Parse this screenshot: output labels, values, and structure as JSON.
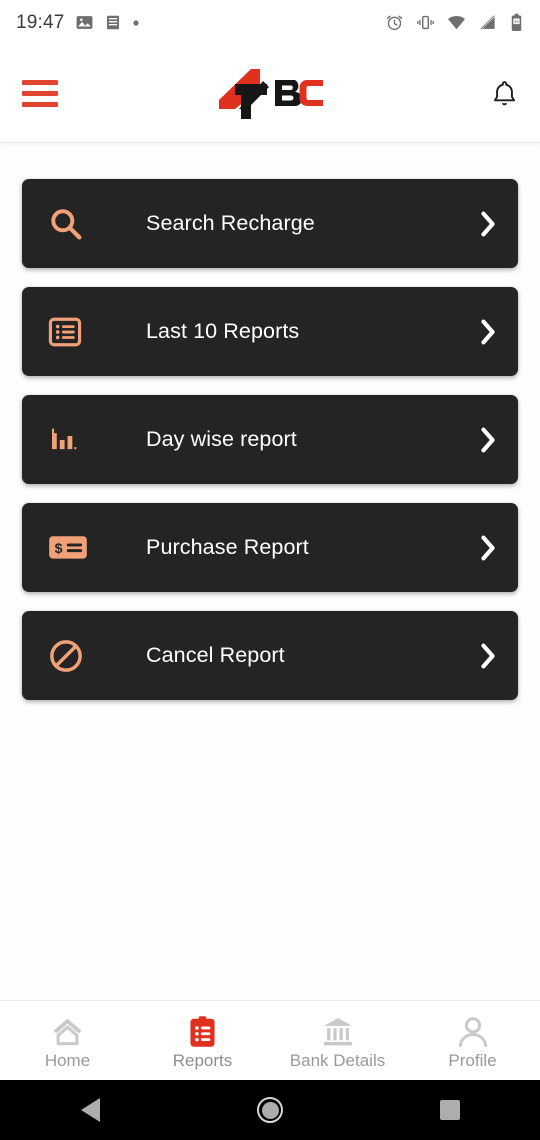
{
  "status_bar": {
    "time": "19:47",
    "left_icons": [
      "image-icon",
      "document-icon",
      "dot-icon"
    ],
    "right_icons": [
      "alarm-icon",
      "vibrate-icon",
      "wifi-icon",
      "signal-icon",
      "battery-icon"
    ]
  },
  "header": {
    "menu_icon": "hamburger-menu-icon",
    "logo_text": "47BC",
    "logo_parts": {
      "mark": "47",
      "b": "B",
      "c": "C"
    },
    "notification_icon": "bell-icon",
    "colors": {
      "menu": "#e0462f",
      "logo_red": "#e0301e",
      "logo_dark": "#1a1a1a"
    }
  },
  "menu_cards": [
    {
      "id": "search-recharge",
      "label": "Search Recharge",
      "icon": "search-icon",
      "chevron": "chevron-right-icon"
    },
    {
      "id": "last-10-reports",
      "label": "Last 10 Reports",
      "icon": "list-report-icon",
      "chevron": "chevron-right-icon"
    },
    {
      "id": "day-wise-report",
      "label": "Day wise report",
      "icon": "bar-chart-icon",
      "chevron": "chevron-right-icon"
    },
    {
      "id": "purchase-report",
      "label": "Purchase Report",
      "icon": "invoice-dollar-icon",
      "chevron": "chevron-right-icon"
    },
    {
      "id": "cancel-report",
      "label": "Cancel Report",
      "icon": "ban-circle-icon",
      "chevron": "chevron-right-icon"
    }
  ],
  "card_style": {
    "background": "#242424",
    "icon_color": "#f0a177",
    "text_color": "#ffffff"
  },
  "bottom_nav": {
    "items": [
      {
        "id": "home",
        "label": "Home",
        "icon": "home-icon",
        "active": false
      },
      {
        "id": "reports",
        "label": "Reports",
        "icon": "clipboard-list-icon",
        "active": true
      },
      {
        "id": "bank-details",
        "label": "Bank Details",
        "icon": "bank-icon",
        "active": false
      },
      {
        "id": "profile",
        "label": "Profile",
        "icon": "user-icon",
        "active": false
      }
    ],
    "active_color": "#e0301e",
    "inactive_color": "#c9c9c9"
  },
  "android_nav": {
    "back": "back-triangle-icon",
    "home": "home-circle-icon",
    "recents": "recents-square-icon"
  }
}
